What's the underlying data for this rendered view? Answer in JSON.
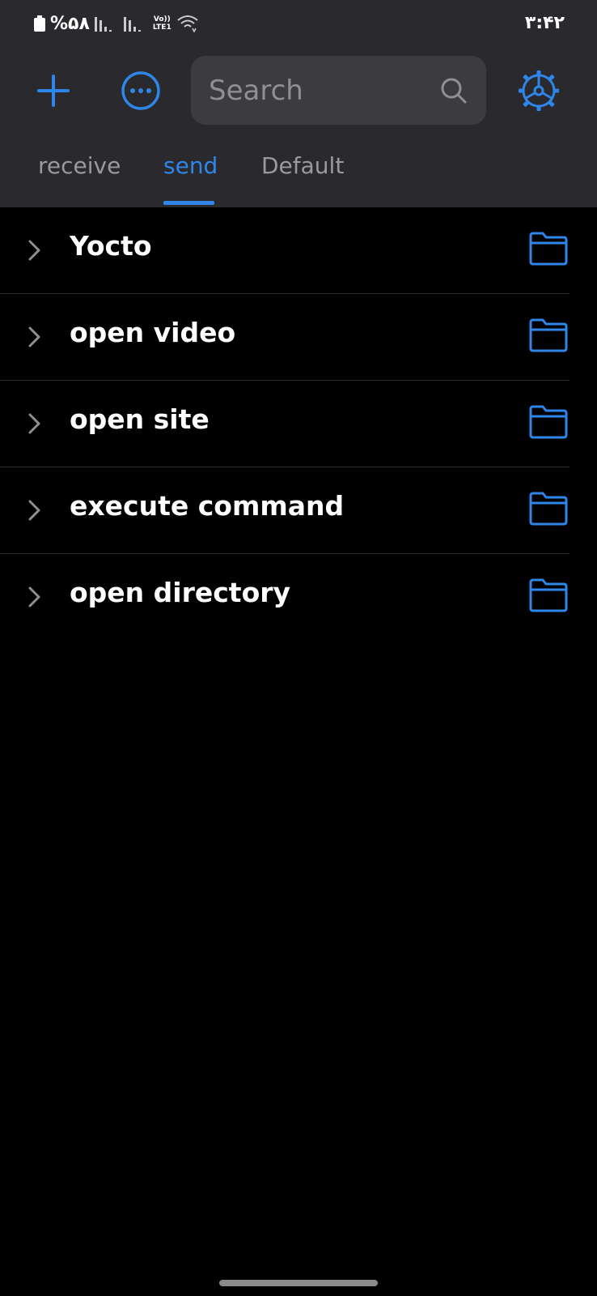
{
  "status_bar": {
    "battery_text": "%۵۸",
    "network_label_top": "Vo))",
    "network_label_bottom": "LTE1",
    "time": "۳:۴۲"
  },
  "toolbar": {
    "add_icon": "plus-icon",
    "more_icon": "ellipsis-circle-icon",
    "settings_icon": "gear-icon",
    "search": {
      "placeholder": "Search",
      "value": ""
    }
  },
  "tabs": [
    {
      "label": "receive",
      "active": false
    },
    {
      "label": "send",
      "active": true
    },
    {
      "label": "Default",
      "active": false
    }
  ],
  "items": [
    {
      "label": "Yocto",
      "icon": "folder-icon"
    },
    {
      "label": "open video",
      "icon": "folder-icon"
    },
    {
      "label": "open site",
      "icon": "folder-icon"
    },
    {
      "label": "execute command",
      "icon": "folder-icon"
    },
    {
      "label": "open directory",
      "icon": "folder-icon"
    }
  ],
  "colors": {
    "accent": "#2f86e8",
    "header_bg": "#2a2a2e",
    "search_bg": "#3c3c40",
    "list_bg": "#000000"
  }
}
